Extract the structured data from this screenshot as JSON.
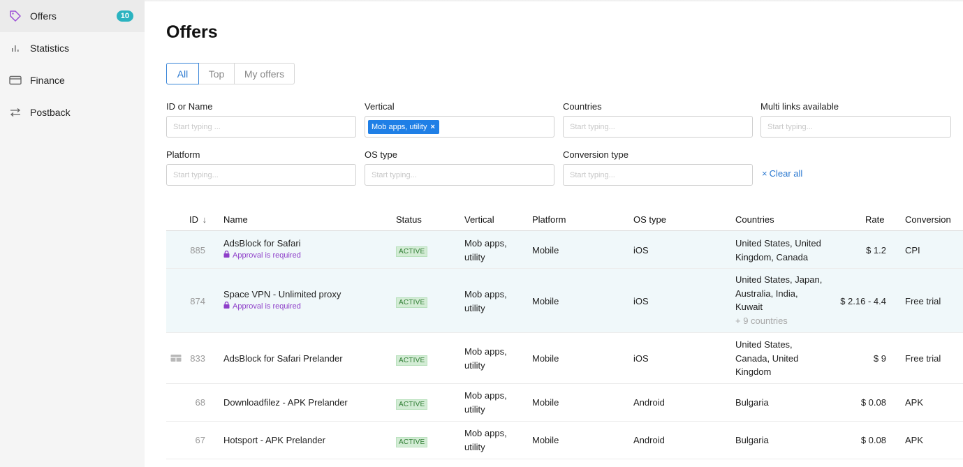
{
  "sidebar": {
    "items": [
      {
        "label": "Offers",
        "icon": "tag-icon",
        "badge": "10",
        "active": true
      },
      {
        "label": "Statistics",
        "icon": "bar-chart-icon"
      },
      {
        "label": "Finance",
        "icon": "card-icon"
      },
      {
        "label": "Postback",
        "icon": "swap-arrows-icon"
      }
    ]
  },
  "page": {
    "title": "Offers"
  },
  "tabs": [
    "All",
    "Top",
    "My offers"
  ],
  "filters": {
    "id_or_name": {
      "label": "ID or Name",
      "placeholder": "Start typing ..."
    },
    "vertical": {
      "label": "Vertical",
      "chip": "Mob apps, utility",
      "chip_remove": "×"
    },
    "countries": {
      "label": "Countries",
      "placeholder": "Start typing..."
    },
    "multi_links": {
      "label": "Multi links available",
      "placeholder": "Start typing..."
    },
    "platform": {
      "label": "Platform",
      "placeholder": "Start typing..."
    },
    "os_type": {
      "label": "OS type",
      "placeholder": "Start typing..."
    },
    "conversion_type": {
      "label": "Conversion type",
      "placeholder": "Start typing..."
    },
    "clear_all": "Clear all",
    "clear_icon": "×"
  },
  "table": {
    "columns": {
      "id": "ID",
      "sort_icon": "↓",
      "name": "Name",
      "status": "Status",
      "vertical": "Vertical",
      "platform": "Platform",
      "os_type": "OS type",
      "countries": "Countries",
      "rate": "Rate",
      "conversion": "Conversion"
    },
    "rows": [
      {
        "id": "885",
        "name": "AdsBlock for Safari",
        "approval": "Approval is required",
        "status": "ACTIVE",
        "vertical": [
          "Mob apps,",
          "utility"
        ],
        "platform": "Mobile",
        "os": "iOS",
        "countries": [
          "United States, United",
          "Kingdom, Canada"
        ],
        "more": "",
        "rate": "$ 1.2",
        "conversion": "CPI"
      },
      {
        "id": "874",
        "name": "Space VPN - Unlimited proxy",
        "approval": "Approval is required",
        "status": "ACTIVE",
        "vertical": [
          "Mob apps,",
          "utility"
        ],
        "platform": "Mobile",
        "os": "iOS",
        "countries": [
          "United States, Japan,",
          "Australia, India,",
          "Kuwait"
        ],
        "more": "+ 9 countries",
        "rate": "$ 2.16 - 4.4",
        "conversion": "Free trial"
      },
      {
        "id": "833",
        "name": "AdsBlock for Safari Prelander",
        "approval": "",
        "status": "ACTIVE",
        "vertical": [
          "Mob apps,",
          "utility"
        ],
        "platform": "Mobile",
        "os": "iOS",
        "countries": [
          "United States,",
          "Canada, United",
          "Kingdom"
        ],
        "more": "",
        "rate": "$ 9",
        "conversion": "Free trial"
      },
      {
        "id": "68",
        "name": "Downloadfilez - APK Prelander",
        "approval": "",
        "status": "ACTIVE",
        "vertical": [
          "Mob apps,",
          "utility"
        ],
        "platform": "Mobile",
        "os": "Android",
        "countries": [
          "Bulgaria"
        ],
        "more": "",
        "rate": "$ 0.08",
        "conversion": "APK"
      },
      {
        "id": "67",
        "name": "Hotsport - APK Prelander",
        "approval": "",
        "status": "ACTIVE",
        "vertical": [
          "Mob apps,",
          "utility"
        ],
        "platform": "Mobile",
        "os": "Android",
        "countries": [
          "Bulgaria"
        ],
        "more": "",
        "rate": "$ 0.08",
        "conversion": "APK"
      }
    ]
  },
  "colors": {
    "accent": "#2a78d0",
    "chip": "#1f7fe6",
    "badge": "#2bb3c0",
    "approval": "#8e3fc9",
    "active_bg": "#d3ecd5",
    "row_highlight": "#f0f8fa"
  }
}
